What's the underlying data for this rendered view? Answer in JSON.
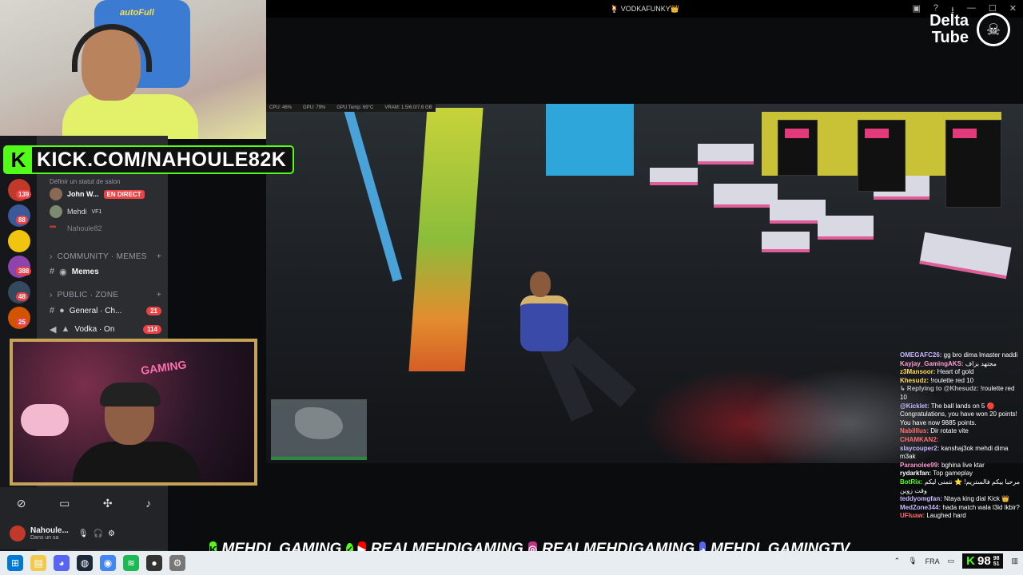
{
  "stream": {
    "title": "🍹 VODKAFUNKY👑",
    "watermark_line1": "Delta",
    "watermark_line2": "Tube"
  },
  "facecam1": {
    "chair_text": "autoFull"
  },
  "kick_banner": {
    "text": "KICK.COM/NAHOULE82K"
  },
  "discord": {
    "status_placeholder": "Définir un statut de salon",
    "voice_users": [
      {
        "name": "John W...",
        "tag": "EN DIRECT"
      },
      {
        "name": "Mehdi",
        "tag": "VF1"
      },
      {
        "name": "Nahoule82",
        "tag": ""
      }
    ],
    "sections": [
      {
        "label": "COMMUNITY · MEMES"
      },
      {
        "label": "PUBLIC · ZONE"
      }
    ],
    "channels": [
      {
        "name": "Memes",
        "badge": ""
      },
      {
        "name": "General · Ch...",
        "badge": "21"
      },
      {
        "name": "Vodka · On",
        "badge": "114"
      }
    ],
    "guild_badges": [
      "139",
      "88",
      "388",
      "48",
      "25"
    ],
    "user": {
      "name": "Nahoule...",
      "status": "Dans un sa"
    }
  },
  "facecam2": {
    "neon_text": "GAMING"
  },
  "game": {
    "stats": [
      "CPU: 46%",
      "GPU: 79%",
      "GPU Temp: 69°C",
      "VRAM: 1.5/6.0/7.6 GB"
    ]
  },
  "chat": [
    {
      "user": "OMEGAFC26:",
      "text": " gg bro dima lmaster naddi",
      "color": "#c9b8ff"
    },
    {
      "user": "Kayjay_GamingAKS:",
      "text": " مجتهد بزاف",
      "color": "#ff9bd1"
    },
    {
      "user": "z3Mansoor:",
      "text": " Heart of gold",
      "color": "#ffd84d"
    },
    {
      "user": "Khesudz:",
      "text": " !roulette red 10",
      "color": "#ffd84d"
    },
    {
      "user": "↳ Replying to @Khesudz:",
      "text": " !roulette red 10",
      "color": "#bbbbbb"
    },
    {
      "user": "@Kicklet:",
      "text": " The ball lands on 5 🔴 Congratulations, you have won 20 points! You have now 9885 points.",
      "color": "#c9b8ff"
    },
    {
      "user": "Nabilllus:",
      "text": " Dir rotate vite",
      "color": "#ff6f6f"
    },
    {
      "user": "CHAMKAN2:",
      "text": "",
      "color": "#ff6f6f"
    },
    {
      "user": "slaycouper2:",
      "text": " kanshaj3ok mehdi dima m3ak",
      "color": "#c9b8ff"
    },
    {
      "user": "Paranolee99:",
      "text": " bghina live ktar",
      "color": "#ff9bd1"
    },
    {
      "user": "rydarkfan:",
      "text": " Top gameplay",
      "color": "#ffffff"
    },
    {
      "user": "BotRix:",
      "text": " مرحبا بيكم فالستريم! ⭐ نتمنى ليكم وقت زوين",
      "color": "#53fc18"
    },
    {
      "user": "teddyomgfan:",
      "text": " Ntaya king dial Kick 👑",
      "color": "#c9b8ff"
    },
    {
      "user": "MedZone344:",
      "text": " hada match wala l3id lkbir?",
      "color": "#c9b8ff"
    },
    {
      "user": "UFluaw:",
      "text": " Laughed hard",
      "color": "#ff6f6f"
    }
  ],
  "social": {
    "kick": "MEHDI_GAMING",
    "youtube": "REALMEHDIGAMING",
    "instagram": "REALMEHDIGAMING",
    "discord": "MEHDI_GAMINGTV"
  },
  "taskbar": {
    "lang": "FRA",
    "perf_value": "98",
    "perf_small_top": "98",
    "perf_small_bottom": "51"
  },
  "colors": {
    "kick_green": "#53fc18",
    "discord_bg": "#2b2d31",
    "live_red": "#ed4245"
  }
}
